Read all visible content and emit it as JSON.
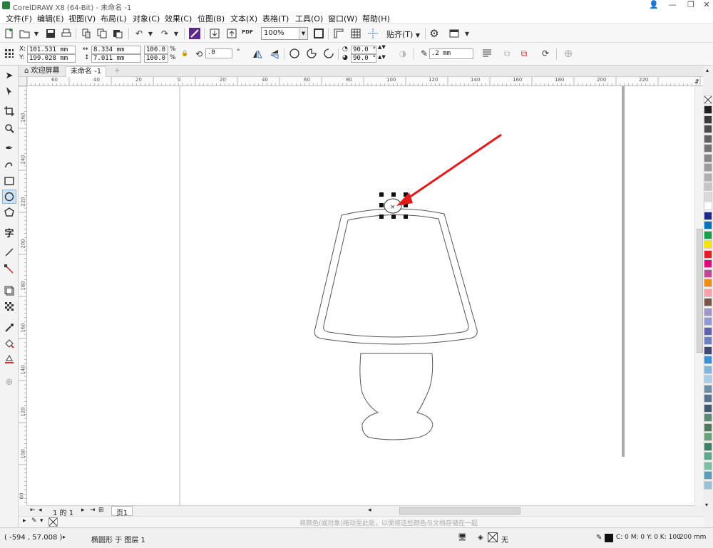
{
  "window": {
    "title": "CorelDRAW X8 (64-Bit) - 未命名 -1",
    "controls": [
      "👤",
      "—",
      "❐",
      "✕"
    ]
  },
  "menu": [
    "文件(F)",
    "编辑(E)",
    "视图(V)",
    "布局(L)",
    "对象(C)",
    "效果(C)",
    "位图(B)",
    "文本(X)",
    "表格(T)",
    "工具(O)",
    "窗口(W)",
    "帮助(H)"
  ],
  "toolbar": {
    "zoom": "100%",
    "snap_label": "贴齐(T)",
    "pdf_label": "PDF",
    "icons": [
      "new-icon",
      "open-icon",
      "save-icon",
      "print-icon",
      "cut-icon",
      "copy-icon",
      "paste-icon",
      "undo-icon",
      "redo-icon",
      "search-content-icon",
      "import-icon",
      "export-icon",
      "pdf-icon",
      "full-screen-icon",
      "rulers-icon",
      "grid-icon",
      "guidelines-icon",
      "options-icon",
      "launch-icon"
    ]
  },
  "properties": {
    "x": "101.531 mm",
    "y": "199.028 mm",
    "width": "8.334 mm",
    "height": "7.011 mm",
    "scale_x": "100.0",
    "scale_y": "100.0",
    "percent": "%",
    "x_label": "X:",
    "y_label": "Y:",
    "rotation": ".0",
    "degree": "°",
    "start_angle": "90.0 °",
    "end_angle": "90.0 °",
    "outline_width": ".2 mm"
  },
  "tabs": {
    "welcome": "欢迎屏幕",
    "document": "未命名 -1",
    "add": "+"
  },
  "ruler": {
    "h_ticks": [
      "60",
      "40",
      "20",
      "0",
      "20",
      "40",
      "60",
      "80",
      "100",
      "120",
      "140",
      "160",
      "180",
      "200",
      "220"
    ],
    "v_ticks": [
      "260",
      "240",
      "220",
      "200",
      "180",
      "160",
      "140",
      "120",
      "100",
      "80"
    ]
  },
  "pagebar": {
    "page_count": "1 的 1",
    "page_tab": "页1"
  },
  "docpalette": {
    "hint": "将颜色(或对象)拖动至此处，以便将这些颜色与文档存储在一起"
  },
  "status": {
    "coords": "( -594 , 57.008 )",
    "object_info": "椭圆形 于 图层 1",
    "fill_none": "无",
    "outline_color": "C: 0 M: 0 Y: 0 K: 100",
    "outline_width": ".200 mm"
  },
  "palette_colors": [
    "#231f20",
    "#3a3a3a",
    "#4d4d4d",
    "#606060",
    "#737373",
    "#878787",
    "#9b9b9b",
    "#b0b0b0",
    "#c5c5c5",
    "#dadada",
    "#ffffff",
    "#1d2a8c",
    "#0a72b8",
    "#16a04a",
    "#f5e600",
    "#e31f25",
    "#e6007e",
    "#c04696",
    "#f08c14",
    "#f4a3a8",
    "#7b5548",
    "#9f97c9",
    "#8f9bd4",
    "#5f63ad",
    "#6d80c0",
    "#404770",
    "#3f8fcf",
    "#7eb8e0",
    "#a8cbe8",
    "#6f8fa8",
    "#57748c",
    "#425a6e",
    "#5c8a78",
    "#4f7a5f",
    "#6aa07b",
    "#3a7f68",
    "#5ea88b",
    "#7cbfa6",
    "#5b9db8",
    "#96c4d6"
  ]
}
